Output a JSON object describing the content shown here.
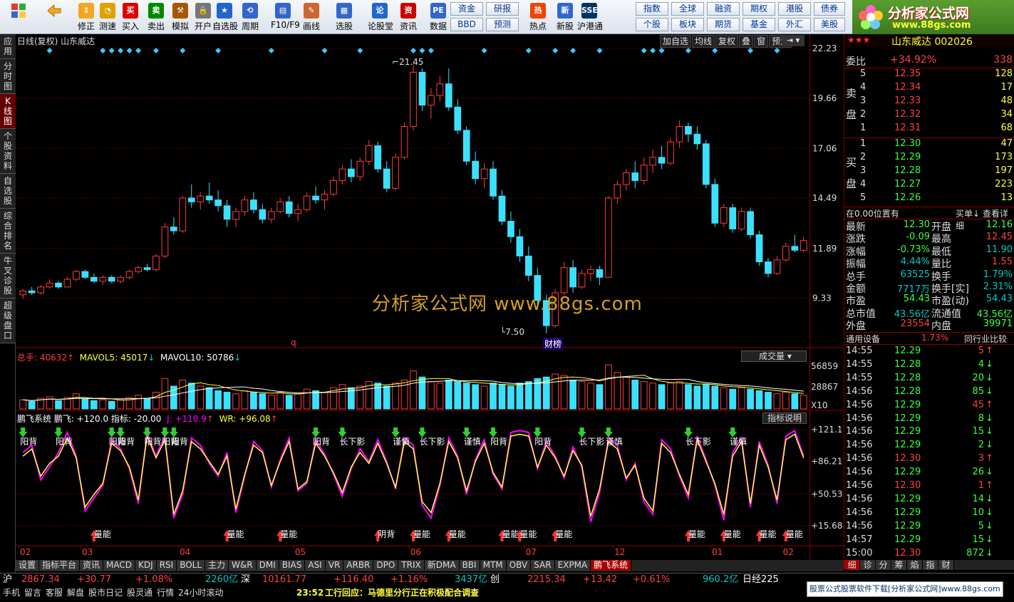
{
  "toolbar": {
    "buttons": [
      {
        "label": "",
        "icon": "back-arrow-icon"
      },
      {
        "label": "修正",
        "icon": "up-down-arrows-icon"
      },
      {
        "label": "测速",
        "icon": "speed-test-icon"
      },
      {
        "label": "买入",
        "icon": "buy-icon"
      },
      {
        "label": "卖出",
        "icon": "sell-icon"
      },
      {
        "label": "模拟",
        "icon": "hammer-icon"
      },
      {
        "label": "开户",
        "icon": "lock-icon"
      },
      {
        "label": "自选股",
        "icon": "watchlist-icon"
      },
      {
        "label": "周期",
        "icon": "period-icon"
      },
      {
        "label": "F10/F9",
        "icon": "f10-icon"
      },
      {
        "label": "画线",
        "icon": "pen-icon"
      },
      {
        "label": "选股",
        "icon": "select-stock-icon"
      },
      {
        "label": "论股堂",
        "icon": "forum-icon"
      },
      {
        "label": "资讯",
        "icon": "news-icon"
      },
      {
        "label": "数据",
        "icon": "data-icon"
      },
      {
        "label": "热点",
        "icon": "hot-icon"
      },
      {
        "label": "新股",
        "icon": "new-stock-icon"
      },
      {
        "label": "沪港通",
        "icon": "hk-connect-icon"
      }
    ],
    "small_buttons": [
      "资金",
      "研报",
      "BBD",
      "预测",
      "指数",
      "全球",
      "融资",
      "期权",
      "港股",
      "债券",
      "个股",
      "板块",
      "期货",
      "基金",
      "外汇",
      "美股"
    ]
  },
  "logo": {
    "title": "分析家公式网",
    "url": "www.88gs.com"
  },
  "left_nav": [
    {
      "label": "应用",
      "active": false
    },
    {
      "label": "分时图",
      "active": false
    },
    {
      "label": "K线图",
      "active": true
    },
    {
      "label": "个股资料",
      "active": false
    },
    {
      "label": "自选股",
      "active": false
    },
    {
      "label": "综合排名",
      "active": false
    },
    {
      "label": "牛叉诊股",
      "active": false
    },
    {
      "label": "超级盘口",
      "active": false
    }
  ],
  "chart_header": {
    "left": "日线(复权)  山东威达",
    "buttons": [
      "加自选",
      "均线",
      "复权",
      "叠",
      "窗",
      "预测"
    ]
  },
  "price_axis": [
    "22.23",
    "19.66",
    "17.06",
    "14.49",
    "11.89",
    "9.33"
  ],
  "annotations": {
    "high": "21.45",
    "low": "7.50",
    "watermark": "分析家公式网  www.88gs.com",
    "marker_q": "q",
    "marker_caibang": "财榜"
  },
  "volume_panel": {
    "header_total": "总手: 40632",
    "mavol5": "MAVOL5: 45017",
    "mavol10": "MAVOL10: 50786",
    "select": "成交量",
    "axis": [
      "56859",
      "28867",
      "X10"
    ]
  },
  "indicator_panel": {
    "header": "鹏飞系统 鹏飞: +120.0 指标: -20.00",
    "j_value": "J: +110.9",
    "wr_value": "WR: +96.08",
    "explain_button": "指标说明",
    "axis": [
      "+121.1",
      "+86.21",
      "+50.53",
      "+15.68"
    ],
    "top_labels": [
      "阳背",
      "阳背",
      "阳背",
      "阳背",
      "阳背",
      "阳背",
      "阳背",
      "阳背",
      "长下影",
      "谨慎",
      "长下影",
      "谨慎",
      "阳背",
      "阳背",
      "长下影",
      "谨慎",
      "长下影",
      "谨慎"
    ],
    "bottom_labels": [
      "量能",
      "量能",
      "量能",
      "量能",
      "阴背",
      "量能",
      "量能",
      "量能",
      "量能",
      "量能",
      "量能",
      "量能",
      "量能"
    ]
  },
  "x_axis": [
    "02",
    "03",
    "04",
    "05",
    "06",
    "07",
    "12",
    "01",
    "02"
  ],
  "bottom_tabs": [
    "设置",
    "指标平台",
    "资讯",
    "MACD",
    "KDJ",
    "RSI",
    "BOLL",
    "主力",
    "W&R",
    "DMI",
    "BIAS",
    "ASI",
    "VR",
    "ARBR",
    "DPO",
    "TRIX",
    "新DMA",
    "BBI",
    "MTM",
    "OBV",
    "SAR",
    "EXPMA",
    "鹏飞系统"
  ],
  "right_panel": {
    "stock_name": "山东威达 002026",
    "weibi_label": "委比",
    "weibi": "+34.92%",
    "weicha": "338",
    "sell_label": "卖盘",
    "sells": [
      {
        "n": "5",
        "p": "12.35",
        "v": "128"
      },
      {
        "n": "4",
        "p": "12.34",
        "v": "17"
      },
      {
        "n": "3",
        "p": "12.33",
        "v": "48"
      },
      {
        "n": "2",
        "p": "12.32",
        "v": "34"
      },
      {
        "n": "1",
        "p": "12.31",
        "v": "68"
      }
    ],
    "buy_label": "买盘",
    "buys": [
      {
        "n": "1",
        "p": "12.30",
        "v": "47"
      },
      {
        "n": "2",
        "p": "12.29",
        "v": "173"
      },
      {
        "n": "3",
        "p": "12.28",
        "v": "197"
      },
      {
        "n": "4",
        "p": "12.27",
        "v": "223"
      },
      {
        "n": "5",
        "p": "12.26",
        "v": "13"
      }
    ],
    "position": "在0.00位置有",
    "buy1_detail": "买单↓ 查看详细",
    "quote": [
      [
        "最新",
        "12.30",
        "开盘",
        "12.16"
      ],
      [
        "涨跌",
        "-0.09",
        "最高",
        "12.45"
      ],
      [
        "涨幅",
        "-0.73%",
        "最低",
        "11.90"
      ],
      [
        "振幅",
        "4.44%",
        "量比",
        "1.55"
      ],
      [
        "总手",
        "63525",
        "换手",
        "1.79%"
      ],
      [
        "金额",
        "7717万",
        "换手[实]",
        "2.31%"
      ],
      [
        "市盈",
        "54.43",
        "市盈(动)",
        "54.43"
      ],
      [
        "总市值",
        "43.56亿",
        "流通值",
        "43.56亿"
      ],
      [
        "外盘",
        "23554",
        "内盘",
        "39971"
      ]
    ],
    "industry": "通用设备",
    "industry_pct": "1.73%",
    "compare": "同行业比较",
    "ticks": [
      [
        "14:55",
        "12.29",
        "5",
        "up"
      ],
      [
        "14:55",
        "12.28",
        "4",
        "down"
      ],
      [
        "14:55",
        "12.28",
        "20",
        "down"
      ],
      [
        "14:56",
        "12.28",
        "85",
        "down"
      ],
      [
        "14:56",
        "12.29",
        "45",
        "up"
      ],
      [
        "14:56",
        "12.29",
        "8",
        "down"
      ],
      [
        "14:56",
        "12.29",
        "15",
        "down"
      ],
      [
        "14:56",
        "12.29",
        "2",
        "down"
      ],
      [
        "14:56",
        "12.30",
        "3",
        "up"
      ],
      [
        "14:56",
        "12.29",
        "26",
        "down"
      ],
      [
        "14:56",
        "12.30",
        "1",
        "up"
      ],
      [
        "14:56",
        "12.29",
        "14",
        "down"
      ],
      [
        "14:56",
        "12.29",
        "10",
        "down"
      ],
      [
        "14:56",
        "12.29",
        "5",
        "down"
      ],
      [
        "14:57",
        "12.29",
        "15",
        "down"
      ],
      [
        "15:00",
        "12.30",
        "872",
        "down"
      ]
    ],
    "tabs": [
      "细",
      "诊",
      "分",
      "筹",
      "焰",
      "指",
      "财"
    ]
  },
  "status_bar": {
    "sh_label": "沪",
    "sh_index": "2867.34",
    "sh_chg": "+30.77",
    "sh_pct": "+1.08%",
    "sh_amt": "2260亿",
    "sz_label": "深",
    "sz_index": "10161.77",
    "sz_chg": "+116.40",
    "sz_pct": "+1.16%",
    "sz_amt": "3437亿",
    "cy_label": "创",
    "cy_index": "2215.34",
    "cy_chg": "+13.42",
    "cy_pct": "+0.61%",
    "cy_amt": "960.2亿",
    "nk_label": "日经225"
  },
  "status_bar2": {
    "items": [
      "手机",
      "留言",
      "客服",
      "解盘",
      "股市日记",
      "股灵通",
      "行情",
      "24小时滚动"
    ],
    "news_time": "23:52",
    "news": "工行回应：马德里分行正在积极配合调查",
    "ad": "股票公式股票软件下载[分析家公式网]www.88gs.com"
  },
  "chart_data": {
    "type": "candlestick",
    "ylim": [
      7.5,
      22.23
    ],
    "ohlc": [
      [
        9.5,
        9.8,
        9.3,
        9.7
      ],
      [
        9.7,
        9.9,
        9.5,
        9.6
      ],
      [
        9.6,
        10.0,
        9.5,
        9.9
      ],
      [
        9.9,
        10.3,
        9.8,
        10.1
      ],
      [
        10.1,
        10.2,
        9.8,
        9.9
      ],
      [
        9.9,
        10.4,
        9.9,
        10.3
      ],
      [
        10.3,
        10.8,
        10.2,
        10.7
      ],
      [
        10.7,
        10.8,
        10.3,
        10.4
      ],
      [
        10.4,
        10.6,
        10.1,
        10.2
      ],
      [
        10.2,
        10.5,
        10.0,
        10.4
      ],
      [
        10.4,
        10.5,
        10.1,
        10.2
      ],
      [
        10.2,
        10.5,
        10.1,
        10.4
      ],
      [
        10.4,
        10.8,
        10.3,
        10.7
      ],
      [
        10.7,
        11.0,
        10.6,
        10.9
      ],
      [
        10.9,
        11.1,
        10.7,
        10.8
      ],
      [
        10.8,
        11.6,
        10.7,
        11.5
      ],
      [
        11.5,
        13.2,
        11.4,
        13.0
      ],
      [
        13.0,
        13.5,
        12.6,
        12.8
      ],
      [
        12.8,
        14.6,
        12.7,
        14.5
      ],
      [
        14.5,
        15.2,
        14.0,
        14.3
      ],
      [
        14.3,
        14.8,
        13.9,
        14.6
      ],
      [
        14.6,
        15.3,
        14.2,
        14.4
      ],
      [
        14.4,
        14.9,
        13.8,
        14.1
      ],
      [
        14.1,
        14.4,
        13.0,
        13.4
      ],
      [
        13.4,
        14.0,
        13.0,
        13.8
      ],
      [
        13.8,
        14.6,
        13.6,
        14.4
      ],
      [
        14.4,
        14.8,
        13.7,
        13.9
      ],
      [
        13.9,
        14.2,
        13.2,
        13.4
      ],
      [
        13.4,
        14.0,
        13.2,
        13.8
      ],
      [
        13.8,
        14.5,
        13.7,
        14.3
      ],
      [
        14.3,
        14.6,
        13.5,
        13.7
      ],
      [
        13.7,
        14.2,
        13.3,
        13.9
      ],
      [
        13.9,
        14.8,
        13.8,
        14.6
      ],
      [
        14.6,
        15.1,
        14.2,
        14.4
      ],
      [
        14.4,
        14.9,
        13.9,
        14.7
      ],
      [
        14.7,
        15.6,
        14.6,
        15.4
      ],
      [
        15.4,
        16.2,
        15.2,
        16.0
      ],
      [
        16.0,
        16.5,
        15.3,
        15.6
      ],
      [
        15.6,
        16.6,
        15.4,
        16.4
      ],
      [
        16.4,
        17.5,
        16.2,
        17.2
      ],
      [
        17.2,
        17.4,
        15.8,
        16.0
      ],
      [
        16.0,
        16.4,
        14.8,
        15.0
      ],
      [
        15.0,
        16.8,
        14.9,
        16.6
      ],
      [
        16.6,
        18.4,
        16.5,
        18.2
      ],
      [
        18.2,
        21.45,
        18.0,
        21.0
      ],
      [
        21.0,
        21.2,
        19.0,
        19.3
      ],
      [
        19.3,
        20.2,
        18.6,
        19.8
      ],
      [
        19.8,
        20.8,
        19.5,
        20.4
      ],
      [
        20.4,
        21.2,
        19.0,
        19.2
      ],
      [
        19.2,
        19.6,
        17.8,
        18.0
      ],
      [
        18.0,
        18.2,
        16.2,
        16.4
      ],
      [
        16.4,
        16.9,
        15.2,
        15.5
      ],
      [
        15.5,
        16.3,
        15.0,
        16.0
      ],
      [
        16.0,
        16.4,
        14.4,
        14.6
      ],
      [
        14.6,
        14.9,
        13.1,
        13.3
      ],
      [
        13.3,
        13.8,
        12.2,
        12.5
      ],
      [
        12.5,
        12.9,
        11.2,
        11.5
      ],
      [
        11.5,
        12.0,
        10.2,
        10.5
      ],
      [
        10.5,
        10.9,
        9.0,
        9.2
      ],
      [
        9.2,
        9.5,
        7.5,
        7.9
      ],
      [
        7.9,
        9.8,
        7.8,
        9.6
      ],
      [
        9.6,
        11.2,
        9.5,
        10.9
      ],
      [
        10.9,
        11.3,
        9.6,
        9.9
      ],
      [
        9.9,
        10.8,
        9.8,
        10.6
      ],
      [
        10.6,
        11.0,
        10.2,
        10.8
      ],
      [
        10.8,
        11.0,
        10.0,
        10.4
      ],
      [
        10.4,
        14.6,
        10.4,
        14.5
      ],
      [
        14.5,
        15.4,
        14.2,
        15.2
      ],
      [
        15.2,
        16.0,
        14.9,
        15.8
      ],
      [
        15.8,
        16.4,
        15.0,
        15.4
      ],
      [
        15.4,
        16.6,
        15.2,
        16.2
      ],
      [
        16.2,
        17.0,
        15.8,
        16.6
      ],
      [
        16.6,
        17.2,
        16.0,
        16.3
      ],
      [
        16.3,
        17.6,
        16.2,
        17.4
      ],
      [
        17.4,
        18.5,
        17.1,
        18.2
      ],
      [
        18.2,
        18.4,
        17.4,
        17.8
      ],
      [
        17.8,
        18.2,
        17.0,
        17.3
      ],
      [
        17.3,
        17.5,
        15.0,
        15.2
      ],
      [
        15.2,
        15.5,
        13.0,
        13.2
      ],
      [
        13.2,
        14.2,
        13.0,
        14.0
      ],
      [
        14.0,
        14.2,
        12.7,
        12.9
      ],
      [
        12.9,
        14.0,
        12.8,
        13.8
      ],
      [
        13.8,
        14.0,
        12.4,
        12.6
      ],
      [
        12.6,
        12.8,
        11.0,
        11.2
      ],
      [
        11.2,
        11.4,
        10.4,
        10.6
      ],
      [
        10.6,
        11.5,
        10.5,
        11.3
      ],
      [
        11.3,
        12.2,
        11.2,
        12.0
      ],
      [
        12.0,
        12.6,
        11.7,
        11.8
      ],
      [
        11.8,
        12.5,
        11.7,
        12.3
      ]
    ],
    "volume": [
      12,
      10,
      14,
      16,
      11,
      15,
      20,
      13,
      11,
      12,
      10,
      12,
      15,
      18,
      14,
      22,
      40,
      30,
      38,
      34,
      30,
      28,
      24,
      22,
      20,
      24,
      22,
      20,
      18,
      22,
      18,
      20,
      26,
      24,
      22,
      28,
      32,
      28,
      30,
      36,
      34,
      30,
      34,
      38,
      50,
      42,
      36,
      34,
      38,
      36,
      34,
      32,
      30,
      34,
      32,
      30,
      34,
      36,
      40,
      42,
      46,
      44,
      38,
      36,
      34,
      32,
      58,
      48,
      42,
      38,
      36,
      34,
      32,
      34,
      36,
      32,
      30,
      32,
      30,
      28,
      26,
      28,
      26,
      24,
      22,
      20,
      22,
      20,
      18
    ],
    "indicator": [
      96,
      104,
      66,
      80,
      96,
      118,
      92,
      32,
      46,
      60,
      110,
      100,
      78,
      40,
      118,
      92,
      114,
      24,
      50,
      112,
      104,
      84,
      70,
      96,
      30,
      70,
      108,
      98,
      58,
      88,
      112,
      54,
      62,
      110,
      94,
      72,
      48,
      78,
      100,
      86,
      110,
      86,
      56,
      112,
      104,
      38,
      24,
      60,
      112,
      92,
      50,
      88,
      110,
      72,
      56,
      118,
      120,
      118,
      78,
      108,
      92,
      68,
      102,
      80,
      20,
      52,
      112,
      104,
      66,
      84,
      42,
      28,
      110,
      100,
      70,
      46,
      114,
      88,
      60,
      22,
      96,
      112,
      36,
      108,
      82,
      40,
      114,
      120,
      92
    ],
    "indicator2": [
      92,
      100,
      70,
      84,
      92,
      112,
      90,
      36,
      50,
      62,
      106,
      98,
      80,
      44,
      114,
      90,
      110,
      28,
      54,
      108,
      100,
      86,
      72,
      92,
      34,
      72,
      104,
      96,
      60,
      86,
      108,
      56,
      64,
      106,
      92,
      74,
      52,
      80,
      96,
      84,
      106,
      84,
      58,
      108,
      100,
      42,
      30,
      62,
      108,
      90,
      54,
      86,
      106,
      74,
      58,
      114,
      116,
      114,
      80,
      104,
      90,
      70,
      98,
      82,
      26,
      56,
      108,
      100,
      68,
      82,
      46,
      32,
      106,
      96,
      72,
      50,
      110,
      86,
      62,
      28,
      92,
      108,
      40,
      104,
      80,
      44,
      110,
      116,
      90
    ]
  }
}
